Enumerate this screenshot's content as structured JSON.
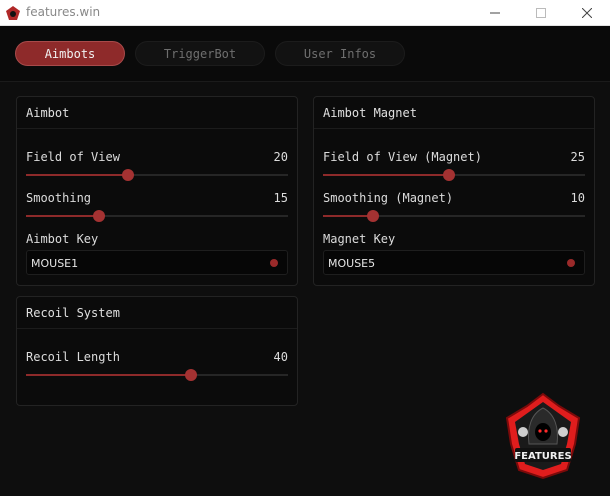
{
  "window": {
    "title": "features.win"
  },
  "tabs": [
    {
      "label": "Aimbots",
      "active": true
    },
    {
      "label": "TriggerBot",
      "active": false
    },
    {
      "label": "User Infos",
      "active": false
    }
  ],
  "panels": {
    "aimbot": {
      "title": "Aimbot",
      "fov": {
        "label": "Field of View",
        "value": "20",
        "fraction": 0.39
      },
      "smoothing": {
        "label": "Smoothing",
        "value": "15",
        "fraction": 0.28
      },
      "key": {
        "label": "Aimbot Key",
        "value": "MOUSE1"
      }
    },
    "magnet": {
      "title": "Aimbot Magnet",
      "fov": {
        "label": "Field of View (Magnet)",
        "value": "25",
        "fraction": 0.48
      },
      "smoothing": {
        "label": "Smoothing (Magnet)",
        "value": "10",
        "fraction": 0.19
      },
      "key": {
        "label": "Magnet Key",
        "value": "MOUSE5"
      }
    },
    "recoil": {
      "title": "Recoil System",
      "length": {
        "label": "Recoil Length",
        "value": "40",
        "fraction": 0.63
      }
    }
  },
  "logo": {
    "text": "FEATURES"
  },
  "colors": {
    "accent": "#8e2a2a",
    "knob": "#a43232",
    "background": "#0e0e0e",
    "panel": "#0b0b0b"
  }
}
